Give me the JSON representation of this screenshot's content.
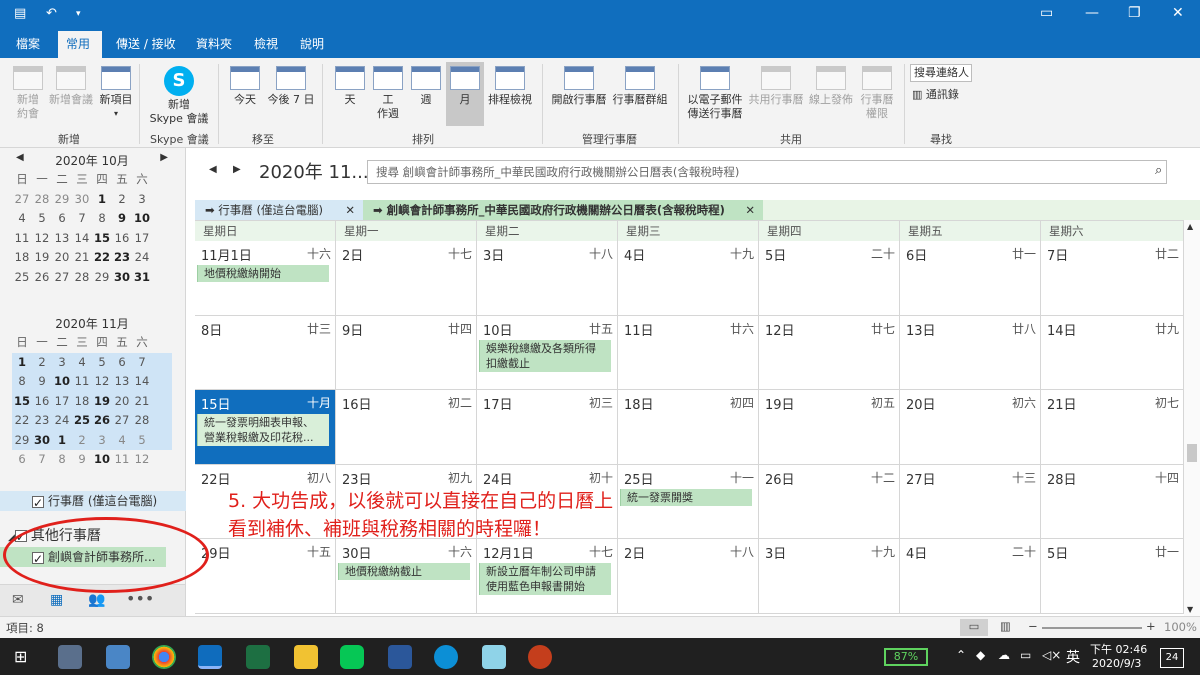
{
  "window": {
    "controls": [
      "▭",
      "—",
      "❐",
      "✕"
    ]
  },
  "menu": {
    "tabs": [
      "檔案",
      "常用",
      "傳送 / 接收",
      "資料夾",
      "檢視",
      "說明"
    ]
  },
  "ribbon": {
    "new_appt": "新增\n約會",
    "new_meeting": "新增會議",
    "new_items": "新項目",
    "skype": "新增\nSkype 會議",
    "today": "今天",
    "next7": "今後 7 日",
    "day": "天",
    "workweek": "工\n作週",
    "week": "週",
    "month": "月",
    "schedule": "排程檢視",
    "open_cal": "開啟行事曆",
    "cal_groups": "行事曆群組",
    "email_cal": "以電子郵件\n傳送行事曆",
    "share_cal": "共用行事曆",
    "publish": "線上發佈",
    "perms": "行事曆\n權限",
    "search_people": "搜尋連絡人",
    "addr_book": "通訊錄",
    "groups": [
      "新增",
      "Skype 會議",
      "移至",
      "排列",
      "管理行事曆",
      "共用",
      "尋找"
    ]
  },
  "mini_oct": {
    "title": "2020年 10月",
    "dow": [
      "日",
      "一",
      "二",
      "三",
      "四",
      "五",
      "六"
    ],
    "weeks": [
      [
        "27",
        "28",
        "29",
        "30",
        "1",
        "2",
        "3"
      ],
      [
        "4",
        "5",
        "6",
        "7",
        "8",
        "9",
        "10"
      ],
      [
        "11",
        "12",
        "13",
        "14",
        "15",
        "16",
        "17"
      ],
      [
        "18",
        "19",
        "20",
        "21",
        "22",
        "23",
        "24"
      ],
      [
        "25",
        "26",
        "27",
        "28",
        "29",
        "30",
        "31"
      ]
    ]
  },
  "mini_nov": {
    "title": "2020年 11月",
    "dow": [
      "日",
      "一",
      "二",
      "三",
      "四",
      "五",
      "六"
    ],
    "weeks": [
      [
        "1",
        "2",
        "3",
        "4",
        "5",
        "6",
        "7"
      ],
      [
        "8",
        "9",
        "10",
        "11",
        "12",
        "13",
        "14"
      ],
      [
        "15",
        "16",
        "17",
        "18",
        "19",
        "20",
        "21"
      ],
      [
        "22",
        "23",
        "24",
        "25",
        "26",
        "27",
        "28"
      ],
      [
        "29",
        "30",
        "1",
        "2",
        "3",
        "4",
        "5"
      ],
      [
        "6",
        "7",
        "8",
        "9",
        "10",
        "11",
        "12"
      ]
    ]
  },
  "sidebar": {
    "my_cal": "行事曆 (僅這台電腦)",
    "other_group": "其他行事曆",
    "other_cal": "創嶼會計師事務所..."
  },
  "main": {
    "date_header": "2020年 11...",
    "search_placeholder": "搜尋 創嶼會計師事務所_中華民國政府行政機關辦公日曆表(含報稅時程)",
    "tab1": "行事曆 (僅這台電腦)",
    "tab2": "創嶼會計師事務所_中華民國政府行政機關辦公日曆表(含報稅時程)",
    "dow": [
      "星期日",
      "星期一",
      "星期二",
      "星期三",
      "星期四",
      "星期五",
      "星期六"
    ],
    "weeks": [
      [
        {
          "d": "11月1日",
          "l": "十六",
          "e": "地價稅繳納開始"
        },
        {
          "d": "2日",
          "l": "十七"
        },
        {
          "d": "3日",
          "l": "十八"
        },
        {
          "d": "4日",
          "l": "十九"
        },
        {
          "d": "5日",
          "l": "二十"
        },
        {
          "d": "6日",
          "l": "廿一"
        },
        {
          "d": "7日",
          "l": "廿二"
        }
      ],
      [
        {
          "d": "8日",
          "l": "廿三"
        },
        {
          "d": "9日",
          "l": "廿四"
        },
        {
          "d": "10日",
          "l": "廿五",
          "e": "娛樂稅總繳及各類所得扣繳截止"
        },
        {
          "d": "11日",
          "l": "廿六"
        },
        {
          "d": "12日",
          "l": "廿七"
        },
        {
          "d": "13日",
          "l": "廿八"
        },
        {
          "d": "14日",
          "l": "廿九"
        }
      ],
      [
        {
          "d": "15日",
          "l": "十月",
          "e": "統一發票明細表申報、營業稅報繳及印花稅...",
          "today": true
        },
        {
          "d": "16日",
          "l": "初二"
        },
        {
          "d": "17日",
          "l": "初三"
        },
        {
          "d": "18日",
          "l": "初四"
        },
        {
          "d": "19日",
          "l": "初五"
        },
        {
          "d": "20日",
          "l": "初六"
        },
        {
          "d": "21日",
          "l": "初七"
        }
      ],
      [
        {
          "d": "22日",
          "l": "初八"
        },
        {
          "d": "23日",
          "l": "初九"
        },
        {
          "d": "24日",
          "l": "初十"
        },
        {
          "d": "25日",
          "l": "十一",
          "e": "統一發票開獎"
        },
        {
          "d": "26日",
          "l": "十二"
        },
        {
          "d": "27日",
          "l": "十三"
        },
        {
          "d": "28日",
          "l": "十四"
        }
      ],
      [
        {
          "d": "29日",
          "l": "十五"
        },
        {
          "d": "30日",
          "l": "十六",
          "e": "地價稅繳納截止"
        },
        {
          "d": "12月1日",
          "l": "十七",
          "e": "新設立曆年制公司申請使用藍色申報書開始"
        },
        {
          "d": "2日",
          "l": "十八"
        },
        {
          "d": "3日",
          "l": "十九"
        },
        {
          "d": "4日",
          "l": "二十"
        },
        {
          "d": "5日",
          "l": "廿一"
        }
      ]
    ]
  },
  "annotation": "5. 大功告成，以後就可以直接在自己的日曆上看到補休、補班與稅務相關的時程囉！",
  "status": {
    "items": "項目: 8",
    "zoom": "100%"
  },
  "taskbar": {
    "battery": "87%",
    "lang": "英",
    "time": "下午 02:46",
    "date": "2020/9/3",
    "notif": "24"
  }
}
